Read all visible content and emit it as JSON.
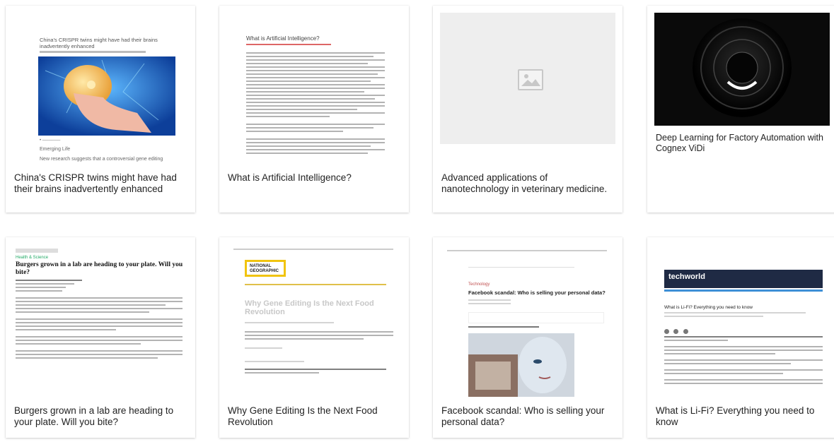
{
  "cards": [
    {
      "title": "China's CRISPR twins might have had their brains inadvertently enhanced",
      "thumb": {
        "headline": "China's CRISPR twins might have had their brains inadvertently enhanced",
        "tag": "Emerging Life",
        "teaser": "New research suggests that a controversial gene editing"
      }
    },
    {
      "title": "What is Artificial Intelligence?",
      "thumb": {
        "headline": "What is Artificial Intelligence?"
      }
    },
    {
      "title": "Advanced applications of nanotechnology in veterinary medicine.",
      "thumb": {
        "icon": "image-placeholder-icon"
      }
    },
    {
      "title": "Deep Learning for Factory Automation with Cognex ViDi",
      "thumb": {}
    },
    {
      "title": "Burgers grown in a lab are heading to your plate. Will you bite?",
      "thumb": {
        "section": "Health & Science",
        "headline": "Burgers grown in a lab are heading to your plate. Will you bite?"
      }
    },
    {
      "title": "Why Gene Editing Is the Next Food Revolution",
      "thumb": {
        "logo": "NATIONAL GEOGRAPHIC",
        "headline": "Why Gene Editing Is the Next Food Revolution"
      }
    },
    {
      "title": "Facebook scandal: Who is selling your personal data?",
      "thumb": {
        "section": "Technology",
        "headline": "Facebook scandal: Who is selling your personal data?"
      }
    },
    {
      "title": "What is Li-Fi? Everything you need to know",
      "thumb": {
        "logo": "techworld",
        "headline": "What is Li-Fi? Everything you need to know"
      }
    }
  ]
}
